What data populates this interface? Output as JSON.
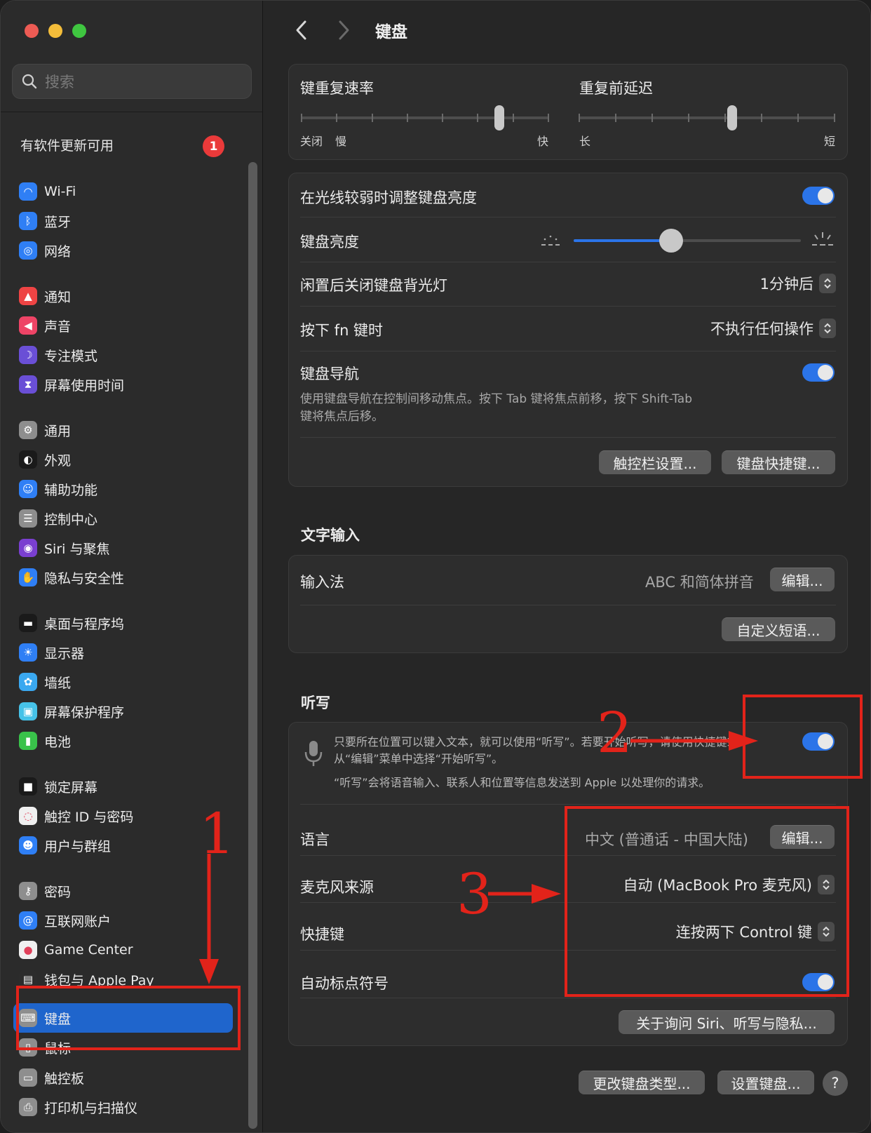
{
  "window": {
    "title": "键盘",
    "search_placeholder": "搜索"
  },
  "sidebar": {
    "update_text": "有软件更新可用",
    "update_badge": "1",
    "items": [
      {
        "label": "Wi-Fi",
        "icon": "wifi-icon",
        "color": "#2f7ff5"
      },
      {
        "label": "蓝牙",
        "icon": "bluetooth-icon",
        "color": "#2f7ff5"
      },
      {
        "label": "网络",
        "icon": "globe-icon",
        "color": "#2f7ff5"
      },
      {
        "label": "通知",
        "icon": "bell-icon",
        "color": "#ee4444"
      },
      {
        "label": "声音",
        "icon": "speaker-icon",
        "color": "#ee4466"
      },
      {
        "label": "专注模式",
        "icon": "moon-icon",
        "color": "#6a4fd6"
      },
      {
        "label": "屏幕使用时间",
        "icon": "hourglass-icon",
        "color": "#6a4fd6"
      },
      {
        "label": "通用",
        "icon": "gear-icon",
        "color": "#8e8e8e"
      },
      {
        "label": "外观",
        "icon": "appearance-icon",
        "color": "#1a1a1a"
      },
      {
        "label": "辅助功能",
        "icon": "accessibility-icon",
        "color": "#2f7ff5"
      },
      {
        "label": "控制中心",
        "icon": "control-center-icon",
        "color": "#8e8e8e"
      },
      {
        "label": "Siri 与聚焦",
        "icon": "siri-icon",
        "color": "#7a3fd0"
      },
      {
        "label": "隐私与安全性",
        "icon": "hand-icon",
        "color": "#2f7ff5"
      },
      {
        "label": "桌面与程序坞",
        "icon": "dock-icon",
        "color": "#1a1a1a"
      },
      {
        "label": "显示器",
        "icon": "sun-icon",
        "color": "#2f7ff5"
      },
      {
        "label": "墙纸",
        "icon": "flower-icon",
        "color": "#3aa8f0"
      },
      {
        "label": "屏幕保护程序",
        "icon": "screensaver-icon",
        "color": "#46c2e8"
      },
      {
        "label": "电池",
        "icon": "battery-icon",
        "color": "#39c24a"
      },
      {
        "label": "锁定屏幕",
        "icon": "lock-icon",
        "color": "#1a1a1a"
      },
      {
        "label": "触控 ID 与密码",
        "icon": "fingerprint-icon",
        "color": "#f0f0f0"
      },
      {
        "label": "用户与群组",
        "icon": "users-icon",
        "color": "#2f7ff5"
      },
      {
        "label": "密码",
        "icon": "key-icon",
        "color": "#8e8e8e"
      },
      {
        "label": "互联网账户",
        "icon": "at-icon",
        "color": "#2f7ff5"
      },
      {
        "label": "Game Center",
        "icon": "game-center-icon",
        "color": "#f0f0f0"
      },
      {
        "label": "钱包与 Apple Pay",
        "icon": "wallet-icon",
        "color": "#2c2c2c"
      },
      {
        "label": "键盘",
        "icon": "keyboard-icon",
        "color": "#8e8e8e"
      },
      {
        "label": "鼠标",
        "icon": "mouse-icon",
        "color": "#8e8e8e"
      },
      {
        "label": "触控板",
        "icon": "trackpad-icon",
        "color": "#8e8e8e"
      },
      {
        "label": "打印机与扫描仪",
        "icon": "printer-icon",
        "color": "#8e8e8e"
      }
    ],
    "active_index": 25
  },
  "repeat": {
    "rate_label": "键重复速率",
    "rate_left": "关闭",
    "rate_slow": "慢",
    "rate_fast": "快",
    "rate_value": 0.8,
    "delay_label": "重复前延迟",
    "delay_long": "长",
    "delay_short": "短",
    "delay_value": 0.6
  },
  "keyboard": {
    "adjust_brightness_label": "在光线较弱时调整键盘亮度",
    "adjust_brightness_on": true,
    "brightness_label": "键盘亮度",
    "brightness_value": 0.43,
    "backlight_off_label": "闲置后关闭键盘背光灯",
    "backlight_off_value": "1分钟后",
    "fn_label": "按下 fn 键时",
    "fn_value": "不执行任何操作",
    "nav_label": "键盘导航",
    "nav_desc_1": "使用键盘导航在控制间移动焦点。按下 Tab 键将焦点前移，按下 Shift-Tab",
    "nav_desc_2": "键将焦点后移。",
    "nav_on": true,
    "touchbar_btn": "触控栏设置...",
    "shortcuts_btn": "键盘快捷键..."
  },
  "text_input": {
    "section": "文字输入",
    "input_label": "输入法",
    "input_value": "ABC 和简体拼音",
    "edit_btn": "编辑...",
    "custom_btn": "自定义短语..."
  },
  "dictation": {
    "section": "听写",
    "desc_1": "只要所在位置可以键入文本，就可以使用“听写”。若要开始听写，请使用快捷键或",
    "desc_2": "从“编辑”菜单中选择“开始听写”。",
    "desc_3": "“听写”会将语音输入、联系人和位置等信息发送到 Apple 以处理你的请求。",
    "on": true,
    "lang_label": "语言",
    "lang_value": "中文 (普通话 - 中国大陆)",
    "lang_edit": "编辑...",
    "mic_label": "麦克风来源",
    "mic_value": "自动 (MacBook Pro 麦克风)",
    "shortcut_label": "快捷键",
    "shortcut_value": "连按两下 Control 键",
    "punct_label": "自动标点符号",
    "punct_on": true,
    "privacy_btn": "关于询问 Siri、听写与隐私..."
  },
  "footer": {
    "change_type_btn": "更改键盘类型...",
    "setup_btn": "设置键盘...",
    "help": "?"
  },
  "annotations": {
    "n1": "1",
    "n2": "2",
    "n3": "3",
    "color": "#e2231a"
  }
}
